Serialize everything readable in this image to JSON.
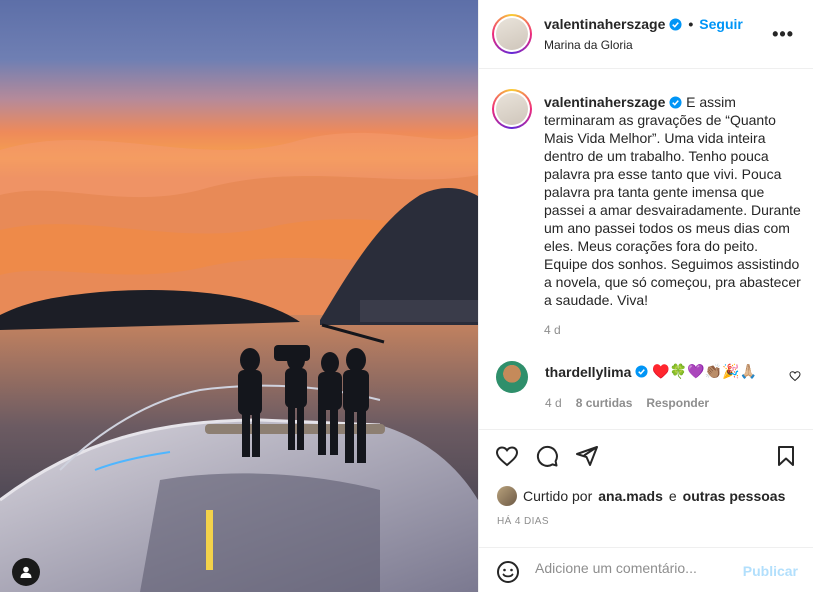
{
  "post": {
    "username": "valentinaherszage",
    "follow_label": "Seguir",
    "location": "Marina da Gloria",
    "more_icon": "more-icon"
  },
  "caption": {
    "username": "valentinaherszage",
    "text": "E assim terminaram as gravações de “Quanto Mais Vida Melhor”. Uma vida inteira dentro de um trabalho. Tenho pouca palavra pra esse tanto que vivi. Pouca palavra pra tanta gente imensa que passei a amar desvairadamente. Durante um ano passei todos os meus dias com eles. Meus corações fora do peito. Equipe dos sonhos. Seguimos assistindo a novela, que só começou, pra abastecer a saudade. Viva!",
    "time": "4 d"
  },
  "comment": {
    "username": "thardellylima",
    "emojis": "♥️🍀💜👏🏽🎉🙏🏼",
    "time": "4 d",
    "likes": "8 curtidas",
    "reply": "Responder"
  },
  "likes": {
    "prefix": "Curtido por",
    "user": "ana.mads",
    "conj": "e",
    "others": "outras pessoas"
  },
  "posted": "HÁ 4 DIAS",
  "add_comment": {
    "placeholder": "Adicione um comentário...",
    "publish": "Publicar"
  },
  "colors": {
    "accent": "#0095f6",
    "publish_disabled": "#b2dffc",
    "muted": "#8e8e8e"
  }
}
